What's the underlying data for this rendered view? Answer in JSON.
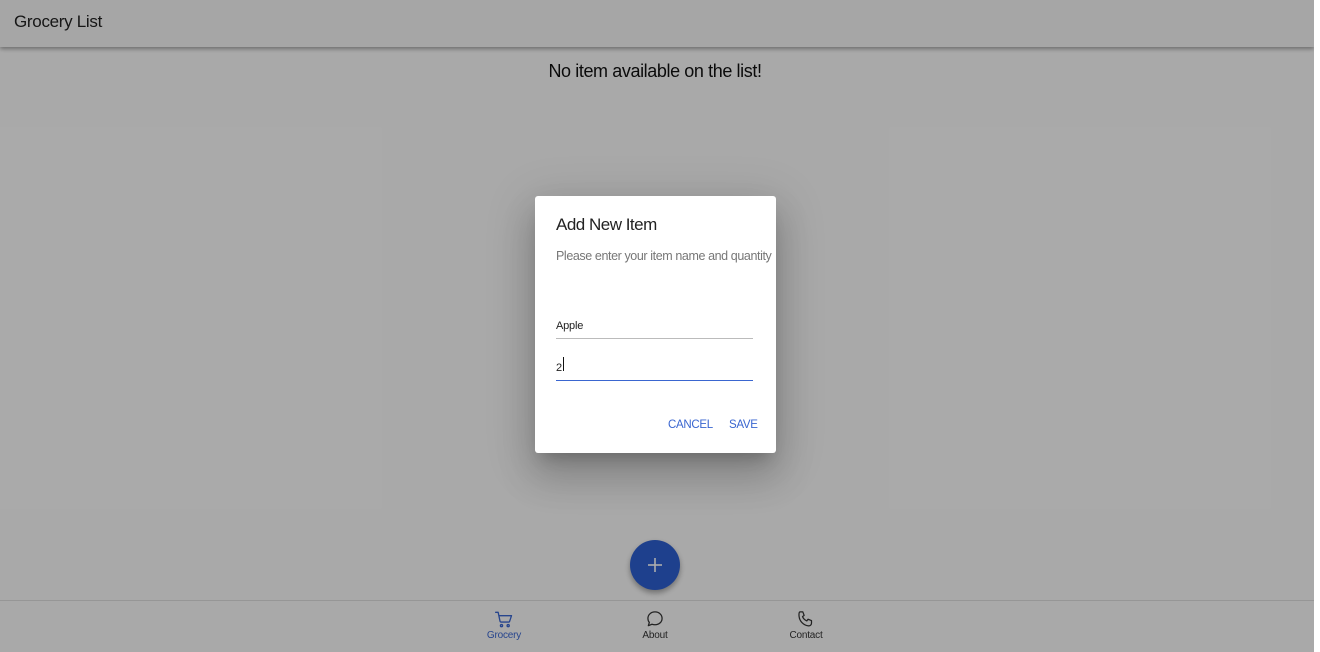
{
  "app": {
    "title": "Grocery List",
    "empty_message": "No item available on the list!"
  },
  "colors": {
    "accent": "#3a66d0",
    "fab": "#2d5fd0",
    "nav_inactive": "#333333"
  },
  "bottom_nav": {
    "items": [
      {
        "label": "Grocery",
        "icon": "cart-icon",
        "active": true
      },
      {
        "label": "About",
        "icon": "chat-bubble-icon",
        "active": false
      },
      {
        "label": "Contact",
        "icon": "phone-icon",
        "active": false
      }
    ]
  },
  "fab": {
    "icon": "plus-icon"
  },
  "dialog": {
    "title": "Add New Item",
    "description": "Please enter your item name and quantity",
    "name_field": {
      "value": "Apple"
    },
    "quantity_field": {
      "value": "2"
    },
    "cancel_label": "CANCEL",
    "save_label": "SAVE"
  }
}
